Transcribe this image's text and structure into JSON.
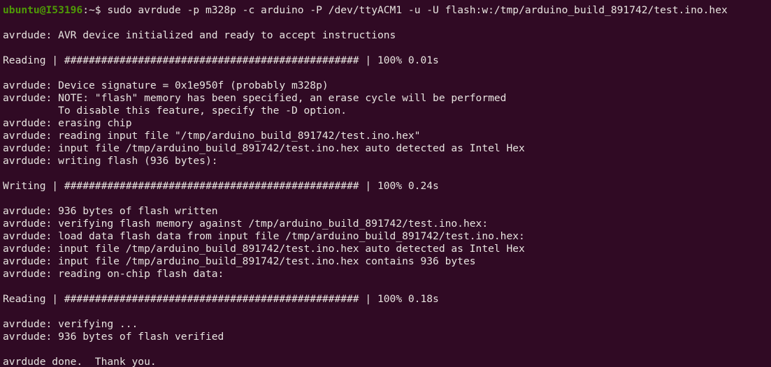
{
  "terminal": {
    "background_color": "#300a24",
    "foreground_color": "#e8e4e0",
    "prompt_color": "#4e9a06",
    "prompt": {
      "user_host": "ubuntu@I53196",
      "separator": ":~$ ",
      "command": "sudo avrdude -p m328p -c arduino -P /dev/ttyACM1 -u -U flash:w:/tmp/arduino_build_891742/test.ino.hex"
    },
    "lines": [
      "",
      "avrdude: AVR device initialized and ready to accept instructions",
      "",
      "Reading | ################################################ | 100% 0.01s",
      "",
      "avrdude: Device signature = 0x1e950f (probably m328p)",
      "avrdude: NOTE: \"flash\" memory has been specified, an erase cycle will be performed",
      "         To disable this feature, specify the -D option.",
      "avrdude: erasing chip",
      "avrdude: reading input file \"/tmp/arduino_build_891742/test.ino.hex\"",
      "avrdude: input file /tmp/arduino_build_891742/test.ino.hex auto detected as Intel Hex",
      "avrdude: writing flash (936 bytes):",
      "",
      "Writing | ################################################ | 100% 0.24s",
      "",
      "avrdude: 936 bytes of flash written",
      "avrdude: verifying flash memory against /tmp/arduino_build_891742/test.ino.hex:",
      "avrdude: load data flash data from input file /tmp/arduino_build_891742/test.ino.hex:",
      "avrdude: input file /tmp/arduino_build_891742/test.ino.hex auto detected as Intel Hex",
      "avrdude: input file /tmp/arduino_build_891742/test.ino.hex contains 936 bytes",
      "avrdude: reading on-chip flash data:",
      "",
      "Reading | ################################################ | 100% 0.18s",
      "",
      "avrdude: verifying ...",
      "avrdude: 936 bytes of flash verified",
      "",
      "avrdude done.  Thank you."
    ]
  }
}
